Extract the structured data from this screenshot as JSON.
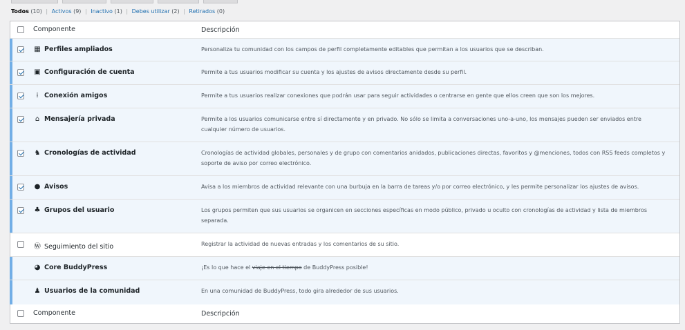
{
  "filters": {
    "all": {
      "label": "Todos",
      "count": "(10)"
    },
    "active": {
      "label": "Activos",
      "count": "(9)"
    },
    "inactive": {
      "label": "Inactivo",
      "count": "(1)"
    },
    "must_use": {
      "label": "Debes utilizar",
      "count": "(2)"
    },
    "retired": {
      "label": "Retirados",
      "count": "(0)"
    },
    "separator": "|"
  },
  "table": {
    "col_component": "Componente",
    "col_description": "Descripción"
  },
  "components": [
    {
      "name": "Perfiles ampliados",
      "icon": "id-card-icon",
      "glyph": "▦",
      "checked": true,
      "active": true,
      "description": "Personaliza tu comunidad con los campos de perfil completamente editables que permitan a los usuarios que se describan."
    },
    {
      "name": "Configuración de cuenta",
      "icon": "account-settings-icon",
      "glyph": "▣",
      "checked": true,
      "active": true,
      "description": "Permite a tus usuarios modificar su cuenta y los ajustes de avisos directamente desde su perfil."
    },
    {
      "name": "Conexión amigos",
      "icon": "friends-icon",
      "glyph": "⁞",
      "checked": true,
      "active": true,
      "description": "Permite a tus usuarios realizar conexiones que podrán usar para seguir actividades o centrarse en gente que ellos creen que son los mejores."
    },
    {
      "name": "Mensajería privada",
      "icon": "inbox-icon",
      "glyph": "⌂",
      "checked": true,
      "active": true,
      "description": "Permite a los usuarios comunicarse entre sí directamente y en privado. No sólo se limita a conversaciones uno-a-uno, los mensajes pueden ser enviados entre cualquier número de usuarios."
    },
    {
      "name": "Cronologías de actividad",
      "icon": "activity-icon",
      "glyph": "♞",
      "checked": true,
      "active": true,
      "description": "Cronologías de actividad globales, personales y de grupo con comentarios anidados, publicaciones directas, favoritos y @menciones, todos con RSS feeds completos y soporte de aviso por correo electrónico."
    },
    {
      "name": "Avisos",
      "icon": "notification-bulb-icon",
      "glyph": "●",
      "checked": true,
      "active": true,
      "description": "Avisa a los miembros de actividad relevante con una burbuja en la barra de tareas y/o por correo electrónico, y les permite personalizar los ajustes de avisos."
    },
    {
      "name": "Grupos del usuario",
      "icon": "groups-icon",
      "glyph": "♣",
      "checked": true,
      "active": true,
      "description": "Los grupos permiten que sus usuarios se organicen en secciones específicas en modo público, privado u oculto con cronologías de actividad y lista de miembros separada."
    },
    {
      "name": "Seguimiento del sitio",
      "icon": "wordpress-icon",
      "glyph": "Ⓦ",
      "checked": false,
      "active": false,
      "description": "Registrar la actividad de nuevas entradas y los comentarios de su sitio."
    },
    {
      "name": "Core BuddyPress",
      "icon": "buddypress-icon",
      "glyph": "◕",
      "checked": null,
      "active": true,
      "description_parts": [
        "¡Es lo que hace el ",
        "viaje en el tiempo",
        " de BuddyPress posible!"
      ]
    },
    {
      "name": "Usuarios de la comunidad",
      "icon": "community-users-icon",
      "glyph": "♟",
      "checked": null,
      "active": true,
      "description": "En una comunidad de BuddyPress, todo gira alrededor de sus usuarios."
    }
  ]
}
